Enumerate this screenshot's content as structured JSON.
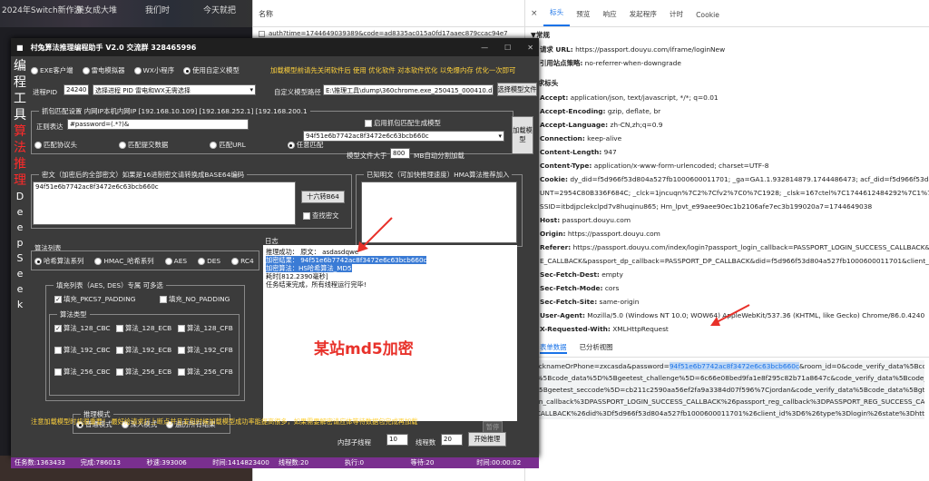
{
  "background": {
    "strip_texts": [
      "2024年Switch新作游",
      "美女成大堆",
      "我们时",
      "今天就把"
    ]
  },
  "devtools": {
    "name_header": "名称",
    "requests": [
      "auth?time=1744649039389&code=ad8335ac015a0fd17aaec879ccac94e7",
      ""
    ],
    "tabs": [
      "×",
      "标头",
      "预览",
      "响应",
      "发起程序",
      "计时",
      "Cookie"
    ],
    "active_tab": "标头",
    "general_title": "▼常规",
    "general": [
      {
        "k": "请求 URL:",
        "v": "https://passport.douyu.com/iframe/loginNew"
      },
      {
        "k": "引用站点策略:",
        "v": "no-referrer-when-downgrade"
      }
    ],
    "req_headers_title": "请求标头",
    "req_headers": [
      {
        "k": "Accept:",
        "v": "application/json, text/javascript, */*; q=0.01"
      },
      {
        "k": "Accept-Encoding:",
        "v": "gzip, deflate, br"
      },
      {
        "k": "Accept-Language:",
        "v": "zh-CN,zh;q=0.9"
      },
      {
        "k": "Connection:",
        "v": "keep-alive"
      },
      {
        "k": "Content-Length:",
        "v": "947"
      },
      {
        "k": "Content-Type:",
        "v": "application/x-www-form-urlencoded; charset=UTF-8"
      },
      {
        "k": "Cookie:",
        "v": "dy_did=f5d966f53d804a527fb1000600011701; _ga=GA1.1.932814879.1744486473; acf_did=f5d966f53d804a5"
      },
      {
        "k": "",
        "v": "UNT=2954C80B336F684C; _clck=1jncuqn%7C2%7Cfv2%7C0%7C1928; _clsk=167ctel%7C1744612484292%7C1%7C0%7Ci.cla"
      },
      {
        "k": "",
        "v": "SSID=itbdjpclekclpd7v8huqinu865; Hm_lpvt_e99aee90ec1b2106afe7ec3b199020a7=1744649038"
      },
      {
        "k": "Host:",
        "v": "passport.douyu.com"
      },
      {
        "k": "Origin:",
        "v": "https://passport.douyu.com"
      },
      {
        "k": "Referer:",
        "v": "https://passport.douyu.com/index/login?passport_login_callback=PASSPORT_LOGIN_SUCCESS_CALLBACK&"
      },
      {
        "k": "",
        "v": "E_CALLBACK&passport_dp_callback=PASSPORT_DP_CALLBACK&did=f5d966f53d804a527fb1000600011701&client_id=6&t"
      },
      {
        "k": "Sec-Fetch-Dest:",
        "v": "empty"
      },
      {
        "k": "Sec-Fetch-Mode:",
        "v": "cors"
      },
      {
        "k": "Sec-Fetch-Site:",
        "v": "same-origin"
      },
      {
        "k": "User-Agent:",
        "v": "Mozilla/5.0 (Windows NT 10.0; WOW64) AppleWebKit/537.36 (KHTML, like Gecko) Chrome/86.0.4240"
      },
      {
        "k": "X-Requested-With:",
        "v": "XMLHttpRequest"
      }
    ],
    "payload_tabs": [
      "表单数据",
      "已分析视图"
    ],
    "form_lines": [
      {
        "pre": "nicknameOrPhone=zxcasda&password=",
        "hl": "94f51e6b7742ac8f3472e6c63bcb660c",
        "post": "&room_id=0&code_verify_data%5Bcode_typ"
      },
      {
        "pre": "a%5Bcode_data%5D%5Bgeetest_challenge%5D=6c66e08bed9fa1e8f295c82b71a8647c&code_verify_data%5Bcode_data",
        "hl": "",
        "post": ""
      },
      {
        "pre": "%5Bgeetest_seccode%5D=cb211c2590aa56ef2fa9a3384d07f596%7Cjordan&code_verify_data%5Bcode_data%5Bgt_v",
        "hl": "",
        "post": ""
      },
      {
        "pre": "gin_callback%3DPASSPORT_LOGIN_SUCCESS_CALLBACK%26passport_reg_callback%3DPASSPORT_REG_SUCCESS_CALLBACK",
        "hl": "",
        "post": ""
      },
      {
        "pre": "_CALLBACK%26did%3Df5d966f53d804a527fb1000600011701%26client_id%3D6%26type%3Dlogin%26state%3Dhttps%253A",
        "hl": "",
        "post": ""
      }
    ]
  },
  "tool": {
    "title": "村兔算法推理编程助手 V2.0   交流群  328465996",
    "sidebar_chars_top": [
      "编",
      "程",
      "工",
      "具"
    ],
    "sidebar_chars_red": [
      "算",
      "法",
      "推",
      "理"
    ],
    "sidebar_chars_ds": [
      "D",
      "e",
      "e",
      "p",
      "S",
      "e",
      "e",
      "k"
    ],
    "mode_radios": [
      "EXE客户端",
      "雷电模拟器",
      "WX小程序",
      "使用自定义模型"
    ],
    "mode_selected": 3,
    "load_hint": "加载模型前请先关闭软件后 使用 优化软件 对本软件优化 以免爆内存 优化一次即可",
    "pid_label": "进程PID",
    "pid_value": "24240",
    "pid_select": "选择进程 PID 雷电和WX无需选择",
    "custom_path_label": "自定义模型路径",
    "custom_path_value": "E:\\推理工具\\dump\\360chrome.exe_250415_000410.dmp",
    "select_model_btn": "选择模型文件",
    "capture_label": "抓包匹配设置 内网IP本机内网IP [192.168.10.109] [192.168.252.1] [192.168.200.1",
    "enable_capture": "启用抓包匹配生成模型",
    "regex_label": "正则表达",
    "regex_value": "#password=(.*?)&",
    "capture_select_value": "94f51e6b7742ac8f3472e6c63bcb660c",
    "load_model_btn": "加载模型",
    "match_radios": [
      "匹配协议头",
      "匹配提交数据",
      "匹配URL",
      "任意匹配"
    ],
    "match_selected": 3,
    "model_size_label": "模型文件大于",
    "model_size_value": "800",
    "model_size_unit": "MB自动分割加载",
    "cipher_label": "密文（加密后的全部密文）如果是16进制密文请转换成BASE64编码",
    "cipher_value": "94f51e6b7742ac8f3472e6c63bcb660c",
    "hex_btn": "十六转B64",
    "find_cipher": "查找密文",
    "known_plain_label": "已知明文（可加快推理速度）HMA算法推荐加入",
    "algo_list_label": "算法列表",
    "algo_radios": [
      "哈希算法系列",
      "HMAC_哈希系列",
      "AES",
      "DES",
      "RC4"
    ],
    "algo_selected": 0,
    "fill_group_label": "填充列表（AES, DES）专属 可多选",
    "fill_pkcs": "填充_PKCS7_PADDING",
    "fill_no": "填充_NO_PADDING",
    "algo_type_label": "算法类型",
    "algo_types": [
      [
        "算法_128_CBC",
        "算法_128_ECB",
        "算法_128_CFB"
      ],
      [
        "算法_192_CBC",
        "算法_192_ECB",
        "算法_192_CFB"
      ],
      [
        "算法_256_CBC",
        "算法_256_ECB",
        "算法_256_CFB"
      ]
    ],
    "infer_mode_label": "推理模式",
    "infer_radios": [
      "普通模式",
      "深入模式",
      "遍历所有结果"
    ],
    "log_label": "日志",
    "log_lines": [
      {
        "text": "推理成功：  原文： asdasdqwe",
        "sel": false
      },
      {
        "text": "加密结果： 94f51e6b7742ac8f3472e6c63bcb660c",
        "sel": true
      },
      {
        "text": "加密算法：HS哈希算法_MD5",
        "sel": true
      },
      {
        "text": "耗时[812.2390毫秒]",
        "sel": false
      },
      {
        "text": "任务结束完成，所有线程运行完毕!",
        "sel": false
      }
    ],
    "annotation": "某站md5加密",
    "notice": "注意加载模型时机很重要！ 最好给请求打上断点并且发包时候加载模型成功率能提高很多，如果需要解密请应体等待数据包完成再加载",
    "pause_btn": "暂停",
    "inner_threads_label": "内部子线程",
    "inner_threads_value": "10",
    "thread_count_label": "线程数",
    "thread_count_value": "20",
    "start_btn": "开始推理",
    "status": [
      "任务数:1363433",
      "完成:786013",
      "秒速:393006",
      "时间:1414823400",
      "线程数:20",
      "执行:0",
      "等待:20",
      "时间:00:00:02"
    ]
  }
}
